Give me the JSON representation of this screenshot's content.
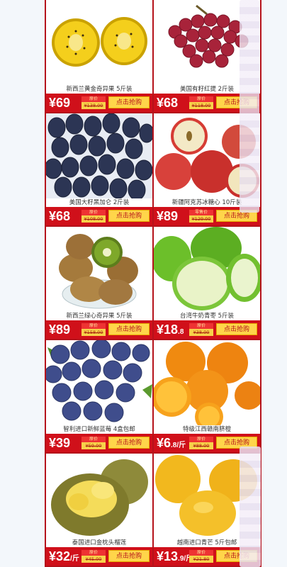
{
  "products": [
    {
      "name": "新西兰黄金奇异果 5斤装",
      "price": "69",
      "original_label": "原价",
      "original_price": "¥138.00",
      "buy_label": "点击抢购",
      "image": "golden-kiwi"
    },
    {
      "name": "美国有籽红提 2斤装",
      "price": "68",
      "original_label": "原价",
      "original_price": "¥118.00",
      "buy_label": "点击抢购",
      "image": "red-grapes"
    },
    {
      "name": "美国大籽黑加仑 2斤装",
      "price": "68",
      "original_label": "原价",
      "original_price": "¥108.00",
      "buy_label": "点击抢购",
      "image": "black-grapes"
    },
    {
      "name": "新疆阿克苏冰糖心 10斤装",
      "price": "89",
      "original_label": "零售价",
      "original_price": "¥129.00",
      "buy_label": "点击抢购",
      "image": "apples"
    },
    {
      "name": "新西兰绿心奇异果 5斤装",
      "price": "89",
      "original_label": "原价",
      "original_price": "¥158.00",
      "buy_label": "点击抢购",
      "image": "green-kiwi"
    },
    {
      "name": "台湾牛奶青枣 5斤装",
      "price": "18",
      "price_suffix": ".8",
      "original_label": "原价",
      "original_price": "¥38.00",
      "buy_label": "点击抢购",
      "image": "green-jujube"
    },
    {
      "name": "智利进口新鲜蓝莓 4盒包邮",
      "price": "39",
      "original_label": "原价",
      "original_price": "¥59.00",
      "buy_label": "点击抢购",
      "image": "blueberries"
    },
    {
      "name": "特级江西赣南脐橙",
      "price": "6",
      "price_suffix": ".8/斤",
      "original_label": "原价",
      "original_price": "¥88.00",
      "buy_label": "点击抢购",
      "image": "oranges"
    },
    {
      "name": "泰国进口金枕头榴莲",
      "price": "32",
      "price_suffix": "/斤",
      "original_label": "原价",
      "original_price": "¥45.00",
      "buy_label": "点击抢购",
      "image": "durian"
    },
    {
      "name": "越南进口青芒 5斤包邮",
      "price": "13",
      "price_suffix": ".9/斤",
      "original_label": "原价",
      "original_price": "¥21.80",
      "buy_label": "点击抢购",
      "image": "mangoes"
    }
  ],
  "currency_symbol": "¥",
  "colors": {
    "accent": "#d0101a",
    "button": "#ffd54a",
    "frame": "#b5121b"
  }
}
